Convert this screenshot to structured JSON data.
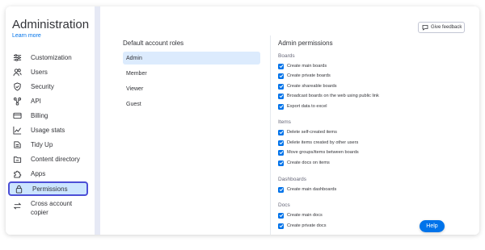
{
  "sidebar": {
    "title": "Administration",
    "learn_more": "Learn more",
    "items": [
      {
        "label": "Customization",
        "icon": "sliders-icon"
      },
      {
        "label": "Users",
        "icon": "users-icon"
      },
      {
        "label": "Security",
        "icon": "shield-icon"
      },
      {
        "label": "API",
        "icon": "api-icon"
      },
      {
        "label": "Billing",
        "icon": "credit-card-icon"
      },
      {
        "label": "Usage stats",
        "icon": "chart-line-icon"
      },
      {
        "label": "Tidy Up",
        "icon": "broom-icon"
      },
      {
        "label": "Content directory",
        "icon": "folder-icon"
      },
      {
        "label": "Apps",
        "icon": "puzzle-icon"
      },
      {
        "label": "Permissions",
        "icon": "lock-icon",
        "selected": true
      },
      {
        "label": "Cross account copier",
        "icon": "transfer-icon"
      }
    ]
  },
  "main": {
    "feedback_label": "Give feedback",
    "roles": {
      "title": "Default account roles",
      "items": [
        "Admin",
        "Member",
        "Viewer",
        "Guest"
      ],
      "selected": "Admin"
    },
    "permissions": {
      "title": "Admin permissions",
      "groups": [
        {
          "title": "Boards",
          "items": [
            "Create main boards",
            "Create private boards",
            "Create shareable boards",
            "Broadcast boards on the web using public link",
            "Export data to excel"
          ]
        },
        {
          "title": "Items",
          "items": [
            "Delete self-created items",
            "Delete items created by other users",
            "Move groups/items between boards",
            "Create docs on items"
          ]
        },
        {
          "title": "Dashboards",
          "items": [
            "Create main dashboards"
          ]
        },
        {
          "title": "Docs",
          "items": [
            "Create main docs",
            "Create private docs"
          ]
        }
      ]
    },
    "help_label": "Help"
  },
  "colors": {
    "accent": "#0073ea",
    "selected_nav_bg": "#cce5ff",
    "selected_nav_border": "#4c4fd6",
    "selected_role_bg": "#dcebfd",
    "divider_strip": "#e6e9f5"
  }
}
